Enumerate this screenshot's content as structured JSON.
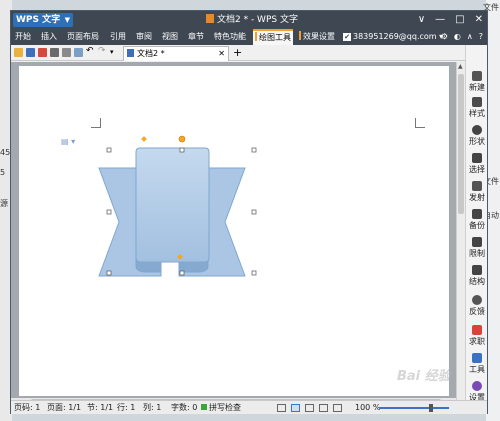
{
  "background": {
    "left_fragments": [
      "45",
      "5",
      "源"
    ],
    "right_fragments": [
      "文件",
      "文件",
      "自动"
    ]
  },
  "titlebar": {
    "logo_label": "WPS 文字",
    "title": "文档2 * - WPS 文字",
    "controls": [
      "∨",
      "—",
      "□",
      "✕"
    ]
  },
  "menubar": {
    "items": [
      "开始",
      "插入",
      "页面布局",
      "引用",
      "审阅",
      "视图",
      "章节",
      "特色功能",
      "绘图工具",
      "效果设置"
    ],
    "active": "绘图工具",
    "account": "383951269@qq.com",
    "right_icons": [
      "gear-icon",
      "skin-icon",
      "collapse-icon",
      "help-icon"
    ]
  },
  "toolbar": {
    "doc_tab_label": "文档2 *",
    "tab_add": "+",
    "right_icons": [
      "cloud-icon",
      "dropdown-icon"
    ]
  },
  "sidepanel": {
    "items": [
      {
        "label": "新建",
        "icon": "new-doc-icon",
        "color": "#555555"
      },
      {
        "label": "样式",
        "icon": "style-icon",
        "color": "#4a4a4a"
      },
      {
        "label": "形状",
        "icon": "shape-icon",
        "color": "#444444"
      },
      {
        "label": "选择",
        "icon": "select-icon",
        "color": "#444444"
      },
      {
        "label": "发射",
        "icon": "link-icon",
        "color": "#555555"
      },
      {
        "label": "备份",
        "icon": "backup-icon",
        "color": "#444444"
      },
      {
        "label": "限制",
        "icon": "restrict-icon",
        "color": "#444444"
      },
      {
        "label": "结构",
        "icon": "structure-icon",
        "color": "#444444"
      },
      {
        "label": "反馈",
        "icon": "feedback-icon",
        "color": "#555555"
      },
      {
        "label": "求职",
        "icon": "job-icon",
        "color": "#d9433a"
      },
      {
        "label": "工具",
        "icon": "tools-icon",
        "color": "#3b72c4"
      },
      {
        "label": "设置",
        "icon": "settings-icon",
        "color": "#7a4bb5"
      }
    ]
  },
  "statusbar": {
    "page_no": "页码: 1",
    "page_count": "页面: 1/1",
    "section": "节: 1/1",
    "row": "行: 1",
    "col": "列: 1",
    "word_count": "字数: 0",
    "spell_check": "拼写检查",
    "zoom": "100 %"
  },
  "shape": {
    "type": "ribbon banner",
    "fill": "#b3cde8",
    "stroke": "#7fa7cf"
  },
  "watermark": "Bai 经验"
}
